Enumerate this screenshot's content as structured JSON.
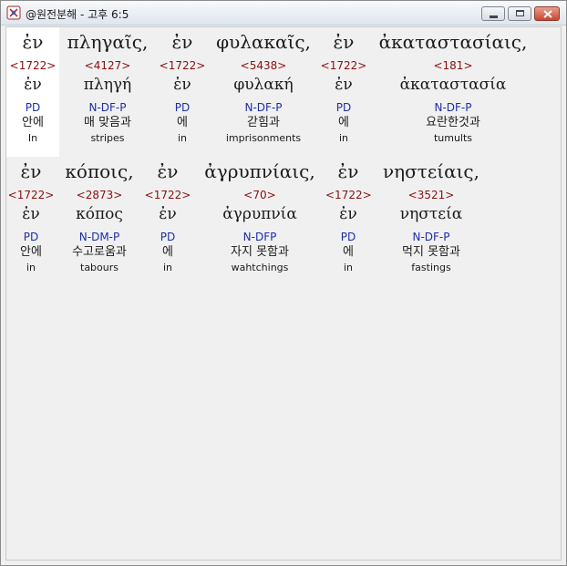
{
  "window": {
    "title": "@원전분해 - 고후 6:5"
  },
  "verse": {
    "lines": [
      [
        {
          "greek": "ἐν",
          "strong": "<1722>",
          "lemma": "ἐν",
          "parse": "PD",
          "korean": "안에",
          "english": "In"
        },
        {
          "greek": "πληγαῖς,",
          "strong": "<4127>",
          "lemma": "πληγή",
          "parse": "N-DF-P",
          "korean": "매 맞음과",
          "english": "stripes"
        },
        {
          "greek": "ἐν",
          "strong": "<1722>",
          "lemma": "ἐν",
          "parse": "PD",
          "korean": "에",
          "english": "in"
        },
        {
          "greek": "φυλακαῖς,",
          "strong": "<5438>",
          "lemma": "φυλακή",
          "parse": "N-DF-P",
          "korean": "갇힘과",
          "english": "imprisonments"
        },
        {
          "greek": "ἐν",
          "strong": "<1722>",
          "lemma": "ἐν",
          "parse": "PD",
          "korean": "에",
          "english": "in"
        },
        {
          "greek": "ἀκαταστασίαις,",
          "strong": "<181>",
          "lemma": "ἀκαταστασία",
          "parse": "N-DF-P",
          "korean": "요란한것과",
          "english": "tumults"
        }
      ],
      [
        {
          "greek": "ἐν",
          "strong": "<1722>",
          "lemma": "ἐν",
          "parse": "PD",
          "korean": "안에",
          "english": "in"
        },
        {
          "greek": "κόποις,",
          "strong": "<2873>",
          "lemma": "κόπος",
          "parse": "N-DM-P",
          "korean": "수고로움과",
          "english": "tabours"
        },
        {
          "greek": "ἐν",
          "strong": "<1722>",
          "lemma": "ἐν",
          "parse": "PD",
          "korean": "에",
          "english": "in"
        },
        {
          "greek": "ἀγρυπνίαις,",
          "strong": "<70>",
          "lemma": "ἀγρυπνία",
          "parse": "N-DFP",
          "korean": "자지 못함과",
          "english": "wahtchings"
        },
        {
          "greek": "ἐν",
          "strong": "<1722>",
          "lemma": "ἐν",
          "parse": "PD",
          "korean": "에",
          "english": "in"
        },
        {
          "greek": "νηστείαις,",
          "strong": "<3521>",
          "lemma": "νηστεία",
          "parse": "N-DF-P",
          "korean": "먹지 못함과",
          "english": "fastings"
        }
      ]
    ]
  },
  "colors": {
    "strong_number": "#8b0f0f",
    "parse_code": "#1c2ea8",
    "text": "#1a1a1a",
    "selection": "#ffffff"
  }
}
